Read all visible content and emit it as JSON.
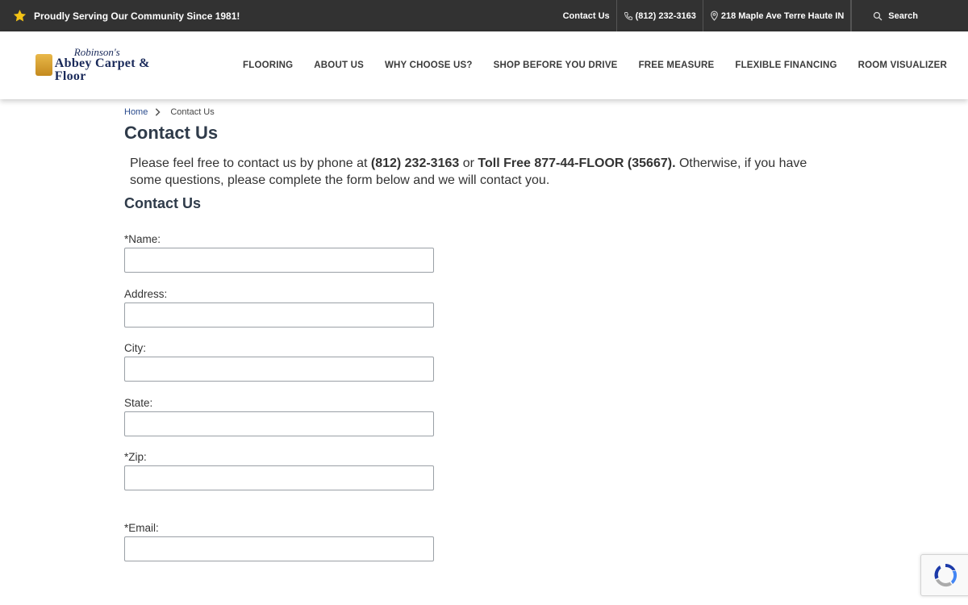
{
  "topbar": {
    "tagline": "Proudly Serving Our Community Since 1981!",
    "contact_link": "Contact Us",
    "phone": "(812) 232-3163",
    "address": "218 Maple Ave Terre Haute IN",
    "search": "Search"
  },
  "brand": {
    "logo_line1": "Robinson's",
    "logo_line2": "Abbey Carpet & Floor"
  },
  "nav": [
    "Flooring",
    "About Us",
    "Why Choose Us?",
    "Shop Before You Drive",
    "Free Measure",
    "Flexible Financing",
    "Room Visualizer"
  ],
  "breadcrumb": {
    "home": "Home",
    "current": "Contact Us"
  },
  "page": {
    "title": "Contact Us",
    "intro_1": "Please feel free to contact us by phone at ",
    "intro_phone": "(812) 232-3163",
    "intro_2": " or ",
    "intro_tollfree": "Toll Free 877-44-FLOOR (35667).",
    "intro_3": " Otherwise, if you have some questions, please complete the form below and we will contact you.",
    "form_title": "Contact Us"
  },
  "form": {
    "fields": [
      {
        "label": "*Name:",
        "value": ""
      },
      {
        "label": "Address:",
        "value": ""
      },
      {
        "label": "City:",
        "value": ""
      },
      {
        "label": "State:",
        "value": ""
      },
      {
        "label": "*Zip:",
        "value": ""
      },
      {
        "label": "*Email:",
        "value": ""
      }
    ]
  },
  "colors": {
    "topbar": "#323232",
    "star": "#f3c316",
    "link": "#2a4b8d"
  }
}
